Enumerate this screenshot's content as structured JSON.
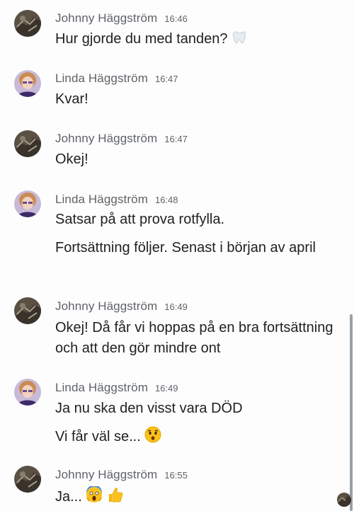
{
  "messages": [
    {
      "sender": "Johnny Häggström",
      "time": "16:46",
      "lines": [
        "Hur gjorde du med tanden?"
      ],
      "emoji": [
        "tooth-emoji"
      ]
    },
    {
      "sender": "Linda Häggström",
      "time": "16:47",
      "lines": [
        "Kvar!"
      ]
    },
    {
      "sender": "Johnny Häggström",
      "time": "16:47",
      "lines": [
        "Okej!"
      ]
    },
    {
      "sender": "Linda Häggström",
      "time": "16:48",
      "lines": [
        "Satsar på att prova rotfylla.",
        "Fortsättning följer. Senast i början av april"
      ]
    },
    {
      "sender": "Johnny Häggström",
      "time": "16:49",
      "lines": [
        "Okej! Då får vi hoppas på en bra fortsättning och att den gör mindre ont"
      ]
    },
    {
      "sender": "Linda Häggström",
      "time": "16:49",
      "lines": [
        "Ja nu ska den visst vara DÖD",
        "Vi får väl se..."
      ],
      "emoji": [
        "hushed-face-emoji"
      ]
    },
    {
      "sender": "Johnny Häggström",
      "time": "16:55",
      "lines": [
        "Ja..."
      ],
      "emoji": [
        "screaming-face-emoji",
        "thumbs-up-emoji"
      ]
    }
  ],
  "colors": {
    "background": "#fdfdfd",
    "sender_text": "#5f6368",
    "message_text": "#202124",
    "scrollbar": "#9aa0a6"
  }
}
